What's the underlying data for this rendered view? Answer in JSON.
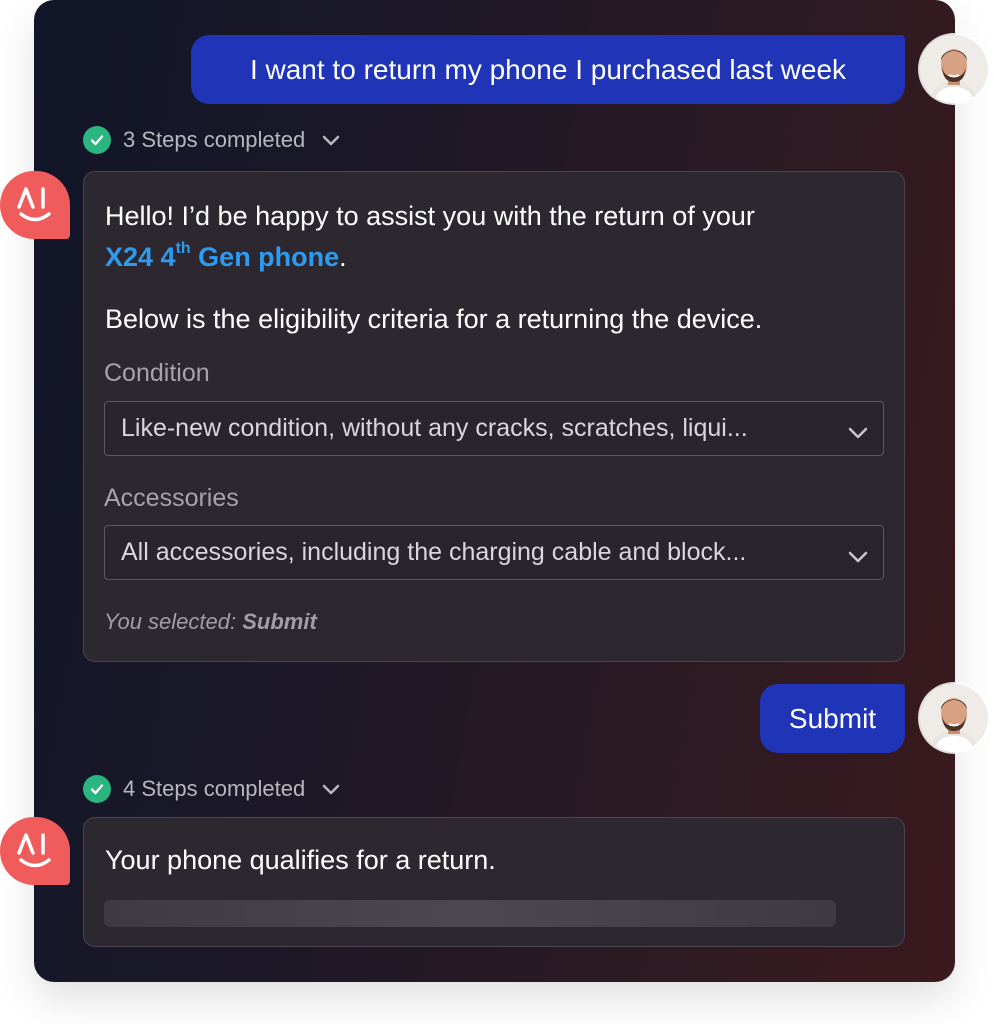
{
  "messages": {
    "user_1": {
      "text": "I want to return my phone I purchased last week"
    },
    "steps_1": {
      "text": "3 Steps completed"
    },
    "ai_1": {
      "greeting_pre": "Hello! I’d be happy to assist you with the return of your",
      "product_name": "X24 4",
      "product_sup": "th",
      "product_suffix": " Gen phone",
      "period": ".",
      "intro": "Below is the eligibility criteria for a returning the device.",
      "condition_label": "Condition",
      "condition_value": "Like-new condition, without any cracks, scratches, liqui...",
      "accessories_label": "Accessories",
      "accessories_value": "All accessories, including the charging cable and block...",
      "selected_prefix": "You selected: ",
      "selected_value": "Submit"
    },
    "user_2": {
      "text": "Submit"
    },
    "steps_2": {
      "text": "4 Steps completed"
    },
    "ai_2": {
      "text": "Your phone qualifies for a return."
    }
  },
  "logo_text": "AI",
  "colors": {
    "user_bubble": "#1f34b7",
    "link": "#2e9bf0",
    "check": "#2bb580",
    "ai_logo": "#f05b5b",
    "card_bg": "#2d2830"
  },
  "icons": [
    "user-avatar-icon",
    "check-circle-icon",
    "chevron-down-icon",
    "ai-logo-icon"
  ]
}
